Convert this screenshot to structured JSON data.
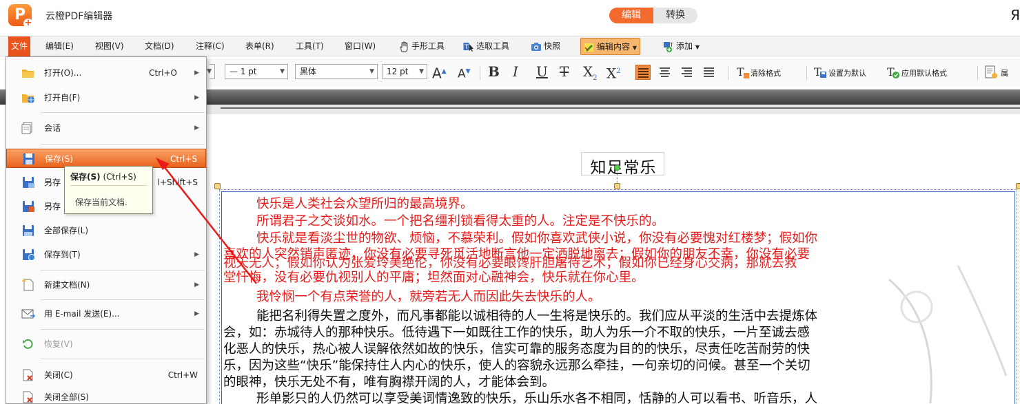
{
  "app": {
    "title": "云橙PDF编辑器",
    "logo_letter": "P",
    "mode_edit": "编辑",
    "mode_convert": "转换",
    "right_glyph": "Я"
  },
  "menubar": {
    "items": [
      "文件",
      "编辑(E)",
      "视图(V)",
      "文档(D)",
      "注释(C)",
      "表单(R)",
      "工具(T)",
      "窗口(W)"
    ],
    "hand_tool": "手形工具",
    "select_tool": "选取工具",
    "snapshot": "快照",
    "edit_content": "编辑内容",
    "add": "添加"
  },
  "format": {
    "line_width": "— 1 pt",
    "font": "黑体",
    "font_size": "12 pt",
    "clear_format": "清除格式",
    "set_default": "设置为默认",
    "apply_default": "应用默认格式",
    "trailing": "属"
  },
  "file_menu": {
    "open": "打开(O)...",
    "open_shortcut": "Ctrl+O",
    "open_from": "打开自(F)",
    "session": "会话",
    "save": "保存(S)",
    "save_shortcut": "Ctrl+S",
    "save_as": "另存",
    "save_as_shortcut": "l+Shift+S",
    "save_as2": "另存",
    "save_all": "全部保存(L)",
    "save_to": "保存到(T)",
    "new_doc": "新建文档(N)",
    "email": "用 E-mail 发送(E)...",
    "restore": "恢复(V)",
    "close": "关闭(C)",
    "close_shortcut": "Ctrl+W",
    "close_all": "关闭全部(S)"
  },
  "tooltip": {
    "title_bold": "保存(S)",
    "title_rest": " (Ctrl+S)",
    "desc": "保存当前文档."
  },
  "document": {
    "title": "知足常乐",
    "red_lines": [
      "快乐是人类社会众望所归的最高境界。",
      "所谓君子之交谈如水。一个把名缰利锁看得太重的人。注定是不快乐的。",
      "快乐就是看淡尘世的物欲、烦恼，不慕荣利。假如你喜欢武侠小说，你没有必要愧对红楼梦；假如你",
      "喜欢的人突然销声匿迹，你没有必要寻死觅活地断言他一定洒脱地离去；假如你的朋友不幸，你没有必要",
      "视天无人；假如你认为张爱玲美绝伦，你没有必要眼馋肝胆屠待艺术；假如你已经身心交病，那就去救",
      "堂忏悔，没有必要仇视别人的平庸；坦然面对心融神会，快乐就在你心里。",
      "我怜悯一个有点荣誉的人，就旁若无人而因此失去快乐的人。"
    ],
    "black_lines": [
      "能把名利得失置之度外，而凡事都能以诚相待的人一生将是快乐的。我们应从平淡的生活中去提炼体",
      "会，如：赤城待人的那种快乐。低待遇下一如既往工作的快乐，助人为乐一介不取的快乐，一片至诚去感",
      "化恶人的快乐，热心被人误解依然如故的快乐，信实可靠的服务态度为目的的快乐，尽责任吃苦耐劳的快",
      "乐，因为这些“快乐”能保持住人内心的快乐，使人的容貌永远那么牵挂，一句亲切的问候。甚至一个关切",
      "的眼神，快乐无处不有，唯有胸襟开阔的人，才能体会到。",
      "形单影只的人仍然可以享受美词情逸致的快乐，乐山乐水各不相同，恬静的人可以看书、听音乐，人"
    ]
  },
  "colors": {
    "accent": "#e9541d",
    "red_text": "#e81b1b",
    "frame_blue": "#3a6ec8"
  }
}
